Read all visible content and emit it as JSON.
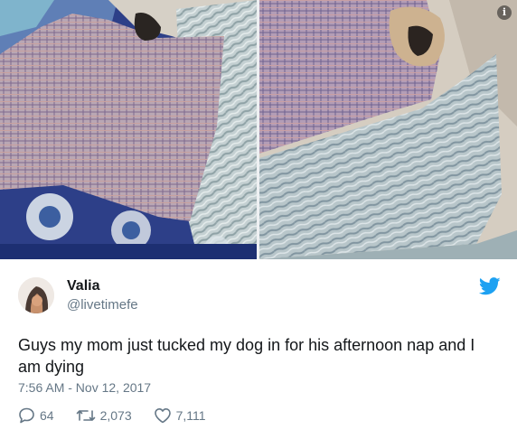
{
  "media": {
    "info_icon": "i"
  },
  "tweet": {
    "author_name": "Valia",
    "author_handle": "@livetimefe",
    "text": "Guys my mom just tucked my dog in for his afternoon nap and I am dying",
    "timestamp": "7:56 AM - Nov 12, 2017",
    "replies": "64",
    "retweets": "2,073",
    "likes": "7,111"
  },
  "colors": {
    "brand": "#1da1f2",
    "text": "#14171a",
    "muted": "#657786"
  },
  "icons": [
    "info-icon",
    "twitter-logo-icon",
    "reply-icon",
    "retweet-icon",
    "like-icon"
  ]
}
